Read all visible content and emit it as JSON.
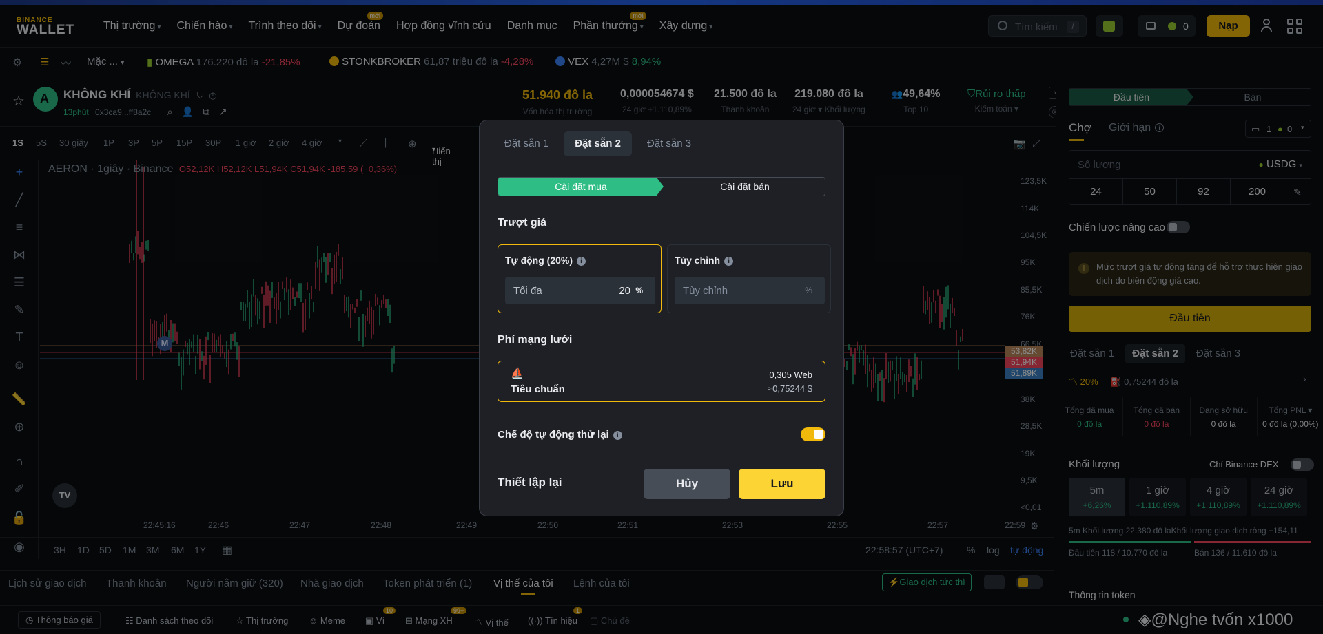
{
  "header": {
    "logo_top": "BINANCE",
    "logo_bottom": "WALLET",
    "nav": [
      {
        "label": "Thị trường",
        "chevron": true
      },
      {
        "label": "Chiến hào",
        "chevron": true
      },
      {
        "label": "Trình theo dõi",
        "chevron": true
      },
      {
        "label": "Dự đoán",
        "badge": "mới"
      },
      {
        "label": "Hợp đồng vĩnh cửu"
      },
      {
        "label": "Danh mục"
      },
      {
        "label": "Phần thưởng",
        "chevron": true,
        "badge": "mới"
      },
      {
        "label": "Xây dựng",
        "chevron": true
      }
    ],
    "search_placeholder": "Tìm kiếm",
    "search_shortcut": "/",
    "wallet_count": "0",
    "deposit_label": "Nạp"
  },
  "ticker": {
    "default_label": "Mặc ...",
    "items": [
      {
        "symbol": "OMEGA",
        "value": "176.220 đô la",
        "change": "-21,85%",
        "dir": "down"
      },
      {
        "symbol": "STONKBROKER",
        "value": "61,87 triệu đô la",
        "change": "-4,28%",
        "dir": "down"
      },
      {
        "symbol": "VEX",
        "value": "4,27M $",
        "change": "8,94%",
        "dir": "up"
      }
    ]
  },
  "token": {
    "name": "KHÔNG KHÍ",
    "name_sub": "KHÔNG KHÍ",
    "age": "13phút",
    "address": "0x3ca9...ff8a2c",
    "market_cap": "51.940 đô la",
    "market_cap_label": "Vốn hóa thị trường",
    "price": "0,000054674 $",
    "price_change": "24 giờ +1.110,89%",
    "liquidity": "21.500 đô la",
    "liquidity_label": "Thanh khoản",
    "volume": "219.080 đô la",
    "volume_label": "24 giờ ▾ Khối lượng",
    "holders_pct": "49,64%",
    "holders_label": "Top 10",
    "risk": "Rủi ro thấp",
    "risk_label": "Kiểm toán ▾"
  },
  "chart_toolbar": {
    "intervals": [
      "1S",
      "5S",
      "30 giây",
      "1P",
      "3P",
      "5P",
      "15P",
      "30P",
      "1 giờ",
      "2 giờ",
      "4 giờ"
    ],
    "display_label": "Hiển thị"
  },
  "chart": {
    "legend_pair": "AERON · 1giây · Binance",
    "o": "O52,12K",
    "h": "H52,12K",
    "l": "L51,94K",
    "c": "C51,94K",
    "change": "-185,59 (−0,36%)",
    "y_ticks": [
      "123,5K",
      "114K",
      "104,5K",
      "95K",
      "85,5K",
      "76K",
      "66,5K",
      "38K",
      "28,5K",
      "19K",
      "9,5K",
      "<0,01"
    ],
    "price_tags": [
      {
        "label": "53,82K",
        "color": "#b8865a"
      },
      {
        "label": "51,94K",
        "color": "#f6465d"
      },
      {
        "label": "51,89K",
        "color": "#3b82c4"
      }
    ],
    "x_ticks": [
      "22:45:16",
      "22:46",
      "22:47",
      "22:48",
      "22:49",
      "22:50",
      "22:51",
      "22:53",
      "22:55",
      "22:57",
      "22:59"
    ],
    "ranges": [
      "3H",
      "1D",
      "5D",
      "1M",
      "3M",
      "6M",
      "1Y"
    ],
    "clock": "22:58:57 (UTC+7)",
    "pct": "%",
    "log": "log",
    "auto": "tự động",
    "marker": "M"
  },
  "bottom_tabs": [
    "Lịch sử giao dịch",
    "Thanh khoản",
    "Người nắm giữ (320)",
    "Nhà giao dịch",
    "Token phát triển (1)",
    "Vị thế của tôi",
    "Lệnh của tôi"
  ],
  "instant_trade": "Giao dịch tức thì",
  "status_bar": {
    "items": [
      "Thông báo giá",
      "Danh sách theo dõi",
      "Thị trường",
      "Meme",
      "Ví",
      "Mạng XH",
      "Vị thế",
      "Tín hiệu",
      "Chủ đề"
    ],
    "badges": {
      "vi": "10",
      "mangxh": "99+",
      "tinhieu": "1"
    },
    "watermark": "@Nghe tvốn x1000"
  },
  "right_panel": {
    "buy_label": "Đầu tiên",
    "sell_label": "Bán",
    "order_market": "Chợ",
    "order_limit": "Giới hạn",
    "preset_num": "1",
    "preset_zero": "0",
    "amount_label": "Số lượng",
    "currency": "USDG",
    "quick_amounts": [
      "24",
      "50",
      "92",
      "200"
    ],
    "advanced": "Chiến lược nâng cao",
    "notice": "Mức trượt giá tự động tăng để hỗ trợ thực hiện giao dịch do biến động giá cao.",
    "buy_button": "Đầu tiên",
    "presets": [
      "Đặt sẵn 1",
      "Đặt sẵn 2",
      "Đặt sẵn 3"
    ],
    "slip_pct": "20%",
    "fee_value": "0,75244 đô la",
    "stats": [
      {
        "label": "Tổng đã mua",
        "value": "0 đô la"
      },
      {
        "label": "Tổng đã bán",
        "value": "0 đô la"
      },
      {
        "label": "Đang sở hữu",
        "value": "0 đô la"
      },
      {
        "label": "Tổng PNL ▾",
        "value": "0 đô la (0,00%)"
      }
    ],
    "volume_title": "Khối lượng",
    "dex_only": "Chỉ Binance DEX",
    "periods": [
      {
        "label": "5m",
        "change": "+6,26%"
      },
      {
        "label": "1 giờ",
        "change": "+1.110,89%"
      },
      {
        "label": "4 giờ",
        "change": "+1.110,89%"
      },
      {
        "label": "24 giờ",
        "change": "+1.110,89%"
      }
    ],
    "vol_5m": "5m Khối lượng 22.380  đô la",
    "net_vol": "Khối lượng giao dịch ròng +154,11",
    "buys": "Đầu tiên 118 / 10.770  đô la",
    "sells": "Bán 136 / 11.610  đô la",
    "token_info": "Thông tin token"
  },
  "modal": {
    "tabs": [
      "Đặt sẵn 1",
      "Đặt sẵn 2",
      "Đặt sẵn 3"
    ],
    "active_tab": 1,
    "buy_setting": "Cài đặt mua",
    "sell_setting": "Cài đặt bán",
    "slippage_title": "Trượt giá",
    "auto_label": "Tự động (20%)",
    "max_label": "Tối đa",
    "max_value": "20",
    "pct": "%",
    "custom_label": "Tùy chỉnh",
    "custom_placeholder": "Tùy chỉnh",
    "fee_title": "Phí mạng lưới",
    "fee_tier": "Tiêu chuẩn",
    "fee_web": "0,305 Web",
    "fee_usd": "≈0,75244 $",
    "auto_retry": "Chế độ tự động thử lại",
    "auto_retry_on": true,
    "reset": "Thiết lập lại",
    "cancel": "Hủy",
    "save": "Lưu"
  },
  "colors": {
    "accent": "#f0b90b",
    "buy": "#2ebd85",
    "sell": "#f6465d",
    "background": "#0b0e11",
    "panel": "#1e2026"
  }
}
